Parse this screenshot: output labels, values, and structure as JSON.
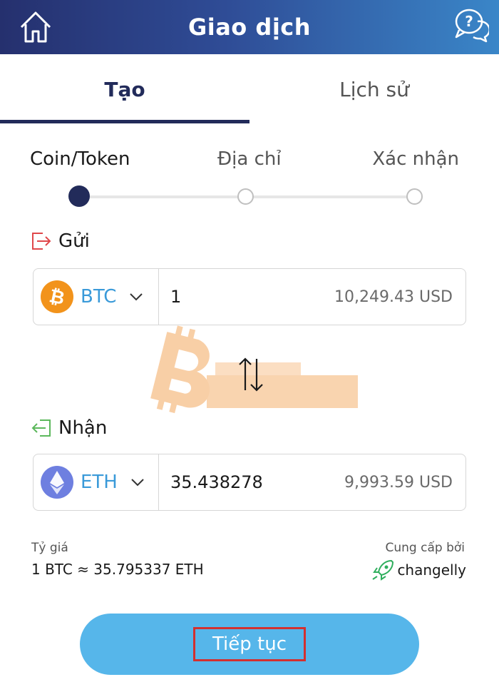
{
  "header": {
    "title": "Giao dịch",
    "home_icon": "home-icon",
    "help_icon": "help-chat-icon"
  },
  "tabs": [
    {
      "label": "Tạo",
      "active": true
    },
    {
      "label": "Lịch sử",
      "active": false
    }
  ],
  "steps": [
    {
      "label": "Coin/Token",
      "state": "current"
    },
    {
      "label": "Địa chỉ",
      "state": "pending"
    },
    {
      "label": "Xác nhận",
      "state": "pending"
    }
  ],
  "send": {
    "label": "Gửi",
    "icon": "send-out-icon",
    "currency": "BTC",
    "coin_icon": "bitcoin-icon",
    "amount": "1",
    "usd_value": "10,249.43 USD"
  },
  "swap_icon": "swap-arrows-icon",
  "receive": {
    "label": "Nhận",
    "icon": "receive-in-icon",
    "currency": "ETH",
    "coin_icon": "ethereum-icon",
    "amount": "35.438278",
    "usd_value": "9,993.59 USD"
  },
  "rate": {
    "title": "Tỷ giá",
    "value": "1 BTC ≈ 35.795337 ETH"
  },
  "provider": {
    "title": "Cung cấp bởi",
    "name": "changelly",
    "icon": "changelly-rocket-icon"
  },
  "continue_label": "Tiếp tục",
  "colors": {
    "header_gradient_start": "#25306e",
    "header_gradient_end": "#3a86c8",
    "active_indicator": "#222b5a",
    "currency_code": "#3a9ad9",
    "btc": "#f2931b",
    "eth": "#6e7fe0",
    "continue_button": "#56b6ea",
    "highlight_box": "#d3302f"
  }
}
